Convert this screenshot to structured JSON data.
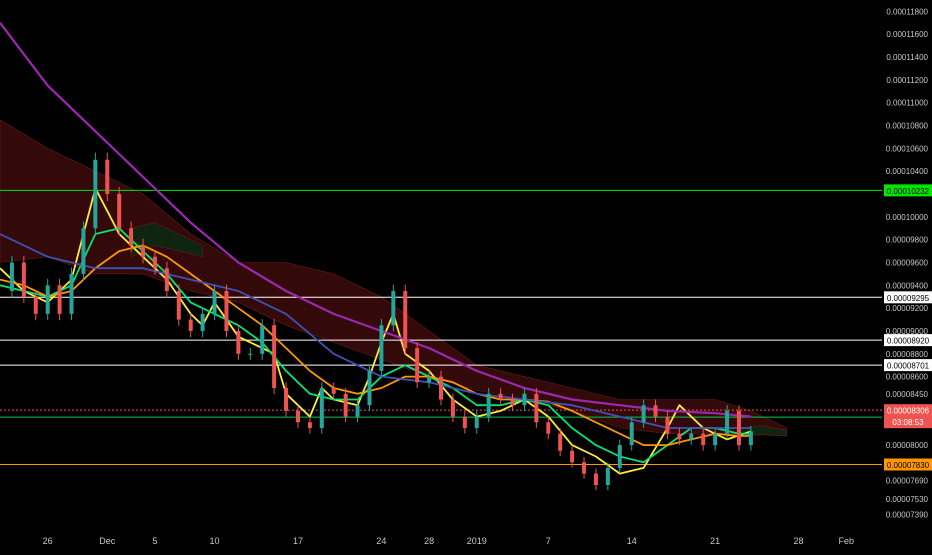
{
  "colors": {
    "background": "#000000",
    "candle_up": "#26a69a",
    "candle_down": "#ef5350",
    "ema_fast": "#ffeb3b",
    "ema_mid": "#00e676",
    "ema_slow": "#ff9800",
    "ma_blue": "#3f51b5",
    "ma_purple": "#9c27b0",
    "cloud_bear": "#3a0a0a",
    "cloud_bull": "#0a2a12",
    "axis_text": "#c8c8c8"
  },
  "chart_data": {
    "type": "line",
    "title": "",
    "xlabel": "",
    "ylabel": "",
    "x_ticks": [
      "26",
      "Dec",
      "5",
      "10",
      "17",
      "24",
      "28",
      "2019",
      "7",
      "14",
      "21",
      "28",
      "Feb"
    ],
    "x_tick_days": [
      0,
      5,
      9,
      14,
      21,
      28,
      32,
      36,
      42,
      49,
      56,
      63,
      67
    ],
    "xlim": [
      -4,
      70
    ],
    "y_ticks": [
      "0.00011800",
      "0.00011600",
      "0.00011400",
      "0.00011200",
      "0.00011000",
      "0.00010800",
      "0.00010600",
      "0.00010400",
      "0.00010000",
      "0.00009800",
      "0.00009600",
      "0.00009400",
      "0.00009200",
      "0.00009000",
      "0.00008800",
      "0.00008600",
      "0.00008450",
      "0.00008000",
      "0.00007690",
      "0.00007530",
      "0.00007390"
    ],
    "ylim": [
      7.3e-05,
      0.000119
    ],
    "horizontal_lines": [
      {
        "label": "0.00010232",
        "value": 0.00010232,
        "color": "#00e600",
        "label_bg": "#00e600",
        "label_color": "#000000"
      },
      {
        "label": "0.00009295",
        "value": 9.295e-05,
        "color": "#ffffff",
        "label_bg": "#ffffff",
        "label_color": "#000000"
      },
      {
        "label": "0.00008920",
        "value": 8.92e-05,
        "color": "#ffffff",
        "label_bg": "#ffffff",
        "label_color": "#000000"
      },
      {
        "label": "0.00008701",
        "value": 8.701e-05,
        "color": "#ffffff",
        "label_bg": "#ffffff",
        "label_color": "#000000"
      },
      {
        "label": "0.00008245",
        "value": 8.245e-05,
        "color": "#00c853",
        "label_bg": "#00e600",
        "label_color": "#000000"
      },
      {
        "label": "0.00007830",
        "value": 7.83e-05,
        "color": "#ff9800",
        "label_bg": "#ff9800",
        "label_color": "#000000"
      }
    ],
    "last_price": {
      "label": "0.00008306",
      "value": 8.306e-05,
      "countdown": "03:08:53",
      "color": "#ef5350"
    },
    "series": [
      {
        "key": "price",
        "type": "candles",
        "color": "#c8c8c8",
        "x": [
          -4,
          -3,
          -2,
          -1,
          0,
          1,
          2,
          3,
          4,
          5,
          6,
          7,
          8,
          9,
          10,
          11,
          12,
          13,
          14,
          15,
          16,
          17,
          18,
          19,
          20,
          21,
          22,
          23,
          24,
          25,
          26,
          27,
          28,
          29,
          30,
          31,
          32,
          33,
          34,
          35,
          36,
          37,
          38,
          39,
          40,
          41,
          42,
          43,
          44,
          45,
          46,
          47,
          48,
          49,
          50,
          51,
          52,
          53,
          54,
          55,
          56,
          57,
          58,
          59
        ],
        "y": [
          9.35e-05,
          9.6e-05,
          9.3e-05,
          9.15e-05,
          9.4e-05,
          9.15e-05,
          9.5e-05,
          9.9e-05,
          0.000105,
          0.000102,
          9.9e-05,
          9.75e-05,
          9.65e-05,
          9.55e-05,
          9.35e-05,
          9.1e-05,
          9e-05,
          9.15e-05,
          9.35e-05,
          9e-05,
          8.8e-05,
          8.8e-05,
          9.05e-05,
          8.5e-05,
          8.3e-05,
          8.2e-05,
          8.15e-05,
          8.5e-05,
          8.45e-05,
          8.25e-05,
          8.35e-05,
          8.65e-05,
          9.05e-05,
          9.35e-05,
          8.85e-05,
          8.55e-05,
          8.6e-05,
          8.4e-05,
          8.25e-05,
          8.15e-05,
          8.25e-05,
          8.45e-05,
          8.4e-05,
          8.35e-05,
          8.45e-05,
          8.2e-05,
          8.1e-05,
          7.95e-05,
          7.85e-05,
          7.75e-05,
          7.65e-05,
          7.8e-05,
          8e-05,
          8.2e-05,
          8.35e-05,
          8.25e-05,
          8.1e-05,
          8.05e-05,
          8.1e-05,
          8e-05,
          8.1e-05,
          8.3e-05,
          8e-05,
          8.12e-05
        ]
      },
      {
        "key": "ema_fast",
        "color": "#ffeb3b",
        "x": [
          -4,
          -2,
          0,
          2,
          3,
          4,
          5,
          6,
          8,
          10,
          12,
          13,
          14,
          16,
          18,
          19,
          20,
          21,
          22,
          23,
          24,
          26,
          27,
          28,
          29,
          30,
          32,
          34,
          36,
          38,
          40,
          42,
          44,
          46,
          48,
          50,
          52,
          53,
          55,
          57,
          59
        ],
        "y": [
          9.55e-05,
          9.35e-05,
          9.25e-05,
          9.45e-05,
          9.85e-05,
          0.0001025,
          0.0001005,
          9.85e-05,
          9.65e-05,
          9.45e-05,
          9.15e-05,
          9.05e-05,
          9.25e-05,
          8.95e-05,
          8.85e-05,
          8.8e-05,
          8.45e-05,
          8.35e-05,
          8.25e-05,
          8.5e-05,
          8.4e-05,
          8.35e-05,
          8.6e-05,
          8.9e-05,
          9.15e-05,
          8.8e-05,
          8.65e-05,
          8.4e-05,
          8.25e-05,
          8.3e-05,
          8.4e-05,
          8.25e-05,
          8e-05,
          7.9e-05,
          7.75e-05,
          7.8e-05,
          8.15e-05,
          8.35e-05,
          8.15e-05,
          8.05e-05,
          8.12e-05
        ]
      },
      {
        "key": "ema_mid",
        "color": "#00e676",
        "x": [
          -4,
          -2,
          0,
          2,
          4,
          6,
          8,
          10,
          12,
          14,
          16,
          18,
          20,
          22,
          24,
          26,
          28,
          30,
          32,
          34,
          36,
          38,
          40,
          42,
          44,
          46,
          48,
          50,
          52,
          54,
          56,
          58,
          59
        ],
        "y": [
          9.4e-05,
          9.35e-05,
          9.3e-05,
          9.4e-05,
          9.85e-05,
          9.9e-05,
          9.7e-05,
          9.5e-05,
          9.25e-05,
          9.15e-05,
          9.05e-05,
          8.9e-05,
          8.65e-05,
          8.45e-05,
          8.4e-05,
          8.4e-05,
          8.6e-05,
          8.7e-05,
          8.6e-05,
          8.5e-05,
          8.35e-05,
          8.35e-05,
          8.4e-05,
          8.35e-05,
          8.15e-05,
          8e-05,
          7.9e-05,
          7.85e-05,
          8e-05,
          8.15e-05,
          8.15e-05,
          8.1e-05,
          8.1e-05
        ]
      },
      {
        "key": "ema_slow",
        "color": "#ff9800",
        "x": [
          -4,
          -2,
          0,
          2,
          4,
          6,
          8,
          10,
          12,
          14,
          16,
          18,
          20,
          22,
          24,
          26,
          28,
          30,
          32,
          34,
          36,
          38,
          40,
          42,
          44,
          46,
          48,
          50,
          52,
          54,
          56,
          58,
          59
        ],
        "y": [
          9.45e-05,
          9.4e-05,
          9.3e-05,
          9.35e-05,
          9.55e-05,
          9.7e-05,
          9.75e-05,
          9.65e-05,
          9.5e-05,
          9.35e-05,
          9.2e-05,
          9.05e-05,
          8.85e-05,
          8.65e-05,
          8.5e-05,
          8.45e-05,
          8.5e-05,
          8.6e-05,
          8.6e-05,
          8.55e-05,
          8.45e-05,
          8.4e-05,
          8.4e-05,
          8.38e-05,
          8.3e-05,
          8.2e-05,
          8.1e-05,
          8e-05,
          8e-05,
          8.05e-05,
          8.1e-05,
          8.08e-05,
          8.08e-05
        ]
      },
      {
        "key": "ma_blue",
        "color": "#3f51b5",
        "x": [
          -4,
          0,
          4,
          8,
          12,
          16,
          20,
          24,
          28,
          32,
          36,
          40,
          44,
          48,
          52,
          56,
          59
        ],
        "y": [
          9.85e-05,
          9.65e-05,
          9.55e-05,
          9.55e-05,
          9.45e-05,
          9.35e-05,
          9.15e-05,
          8.8e-05,
          8.6e-05,
          8.55e-05,
          8.45e-05,
          8.4e-05,
          8.35e-05,
          8.25e-05,
          8.15e-05,
          8.15e-05,
          8.15e-05
        ]
      },
      {
        "key": "ma_purple",
        "color": "#9c27b0",
        "x": [
          -4,
          0,
          4,
          8,
          12,
          16,
          20,
          24,
          28,
          32,
          36,
          40,
          44,
          48,
          52,
          56,
          59
        ],
        "y": [
          0.000117,
          0.0001115,
          0.0001075,
          0.0001035,
          9.95e-05,
          9.6e-05,
          9.35e-05,
          9.15e-05,
          9e-05,
          8.85e-05,
          8.65e-05,
          8.5e-05,
          8.4e-05,
          8.35e-05,
          8.3e-05,
          8.28e-05,
          8.25e-05
        ]
      }
    ],
    "cloud": {
      "bear": [
        {
          "x": [
            -4,
            0,
            4,
            8,
            12,
            16,
            20,
            24,
            28,
            32,
            36,
            40,
            44,
            48,
            52,
            56,
            59,
            62
          ],
          "top": [
            0.0001085,
            0.000106,
            0.000104,
            0.000102,
            9.85e-05,
            9.6e-05,
            9.6e-05,
            9.5e-05,
            9.3e-05,
            9e-05,
            8.7e-05,
            8.6e-05,
            8.5e-05,
            8.4e-05,
            8.4e-05,
            8.4e-05,
            8.3e-05,
            8.15e-05
          ],
          "bottom": [
            9.6e-05,
            9.65e-05,
            9.5e-05,
            9.5e-05,
            9.35e-05,
            9.25e-05,
            9.05e-05,
            8.9e-05,
            8.75e-05,
            8.6e-05,
            8.48e-05,
            8.4e-05,
            8.3e-05,
            8.15e-05,
            8.1e-05,
            8.1e-05,
            8.1e-05,
            8.08e-05
          ]
        }
      ],
      "bull": [
        {
          "x": [
            7,
            9,
            11,
            13
          ],
          "top": [
            9.9e-05,
            9.95e-05,
            9.85e-05,
            9.75e-05
          ],
          "bottom": [
            9.65e-05,
            9.75e-05,
            9.7e-05,
            9.65e-05
          ]
        },
        {
          "x": [
            58,
            60,
            62
          ],
          "top": [
            8.15e-05,
            8.17e-05,
            8.13e-05
          ],
          "bottom": [
            8.08e-05,
            8.09e-05,
            8.08e-05
          ]
        }
      ]
    }
  }
}
